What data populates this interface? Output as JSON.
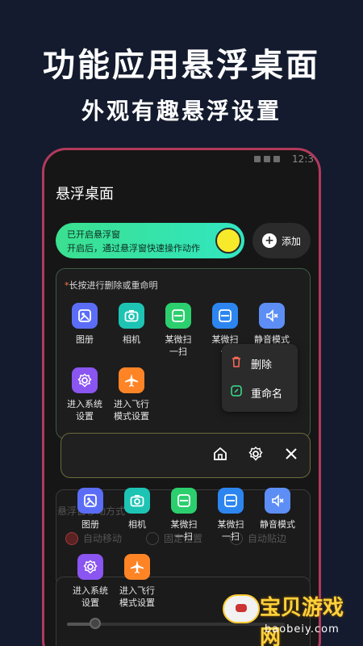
{
  "promo": {
    "title": "功能应用悬浮桌面",
    "subtitle": "外观有趣悬浮设置"
  },
  "status": {
    "time": "12:3"
  },
  "app": {
    "title": "悬浮桌面"
  },
  "toggle": {
    "line1": "已开启悬浮窗",
    "line2": "开启后，通过悬浮窗快速操作动作",
    "on": true
  },
  "add_button": {
    "label": "添加"
  },
  "grid": {
    "hint_star": "*",
    "hint": "长按进行删除或重命明",
    "items": [
      {
        "name": "图册",
        "icon": "gallery-icon",
        "color": "#5b6df7"
      },
      {
        "name": "相机",
        "icon": "camera-icon",
        "color": "#1ec4b3"
      },
      {
        "name": "某微扫一扫",
        "line1": "某微扫",
        "line2": "一扫",
        "icon": "scan-icon",
        "color": "#2ccf6e"
      },
      {
        "name": "某微扫一扫",
        "line1": "某微扫",
        "line2": "一",
        "icon": "scan-icon",
        "color": "#2d86f0"
      },
      {
        "name": "静音模式",
        "line1": "静音模式",
        "icon": "mute-icon",
        "color": "#5d8ef5"
      },
      {
        "name": "进入系统设置",
        "line1": "进入系统",
        "line2": "设置",
        "icon": "gear-icon",
        "color": "#8a55f0"
      },
      {
        "name": "进入飞行模式设置",
        "line1": "进入飞行",
        "line2": "模式设置",
        "icon": "airplane-icon",
        "color": "#ff8426"
      }
    ]
  },
  "context_menu": {
    "delete": "删除",
    "rename": "重命名"
  },
  "float_panel": {
    "icons": [
      "home-icon",
      "gear-icon",
      "close-icon"
    ],
    "items": [
      {
        "name": "图册",
        "icon": "gallery-icon",
        "color": "#5b6df7"
      },
      {
        "name": "相机",
        "icon": "camera-icon",
        "color": "#1ec4b3"
      },
      {
        "line1": "某微扫",
        "line2": "一扫",
        "icon": "scan-icon",
        "color": "#2ccf6e"
      },
      {
        "line1": "某微扫",
        "line2": "一扫",
        "icon": "scan-icon",
        "color": "#2d86f0"
      },
      {
        "name": "静音模式",
        "icon": "mute-icon",
        "color": "#5d8ef5"
      },
      {
        "line1": "进入系统",
        "line2": "设置",
        "icon": "gear-icon",
        "color": "#8a55f0"
      },
      {
        "line1": "进入飞行",
        "line2": "模式设置",
        "icon": "airplane-icon",
        "color": "#ff8426"
      }
    ]
  },
  "background_settings": {
    "section_title": "悬浮窗移动方式",
    "options": [
      "自动移动",
      "固定位置",
      "自动贴边"
    ],
    "selected": "自动移动",
    "slider_level": 0.13
  },
  "watermark": {
    "text": "宝贝游戏网",
    "url": "baobeiy.com"
  },
  "colors": {
    "background": "#141b2e",
    "phone_frame": "#b23a5c",
    "toggle_gradient_start": "#3be08f",
    "toggle_gradient_end": "#31e6c1",
    "knob": "#f7ea2a"
  }
}
